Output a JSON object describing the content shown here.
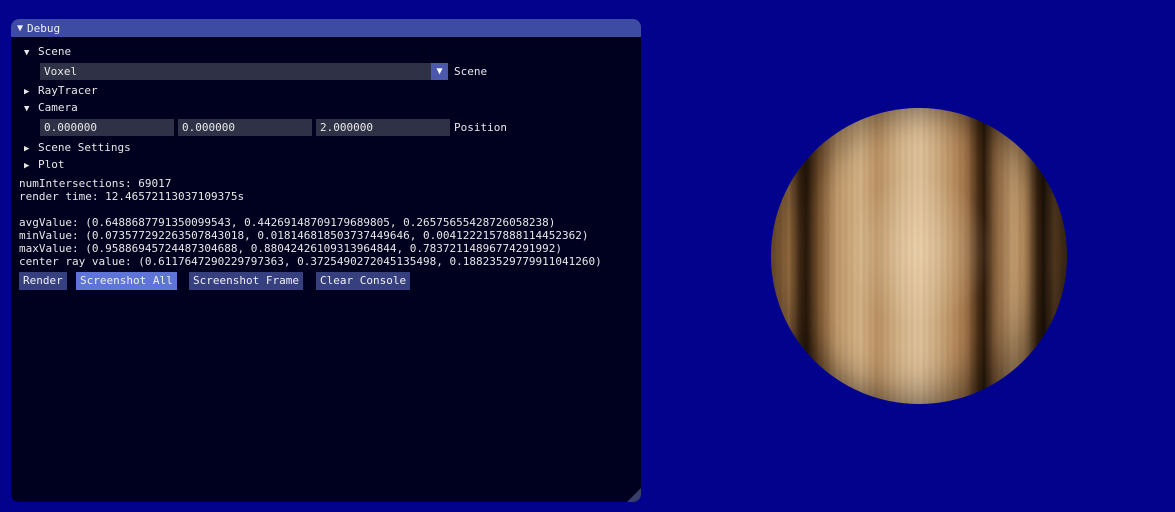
{
  "window": {
    "title": "Debug",
    "title_arrow": "▼"
  },
  "scene": {
    "label": "Scene",
    "selected": "Voxel",
    "combo_label": "Scene"
  },
  "tree": {
    "raytracer": "RayTracer",
    "camera": "Camera",
    "scene_settings": "Scene Settings",
    "plot": "Plot",
    "expanded_arrow": "▼",
    "collapsed_arrow": "▶"
  },
  "camera": {
    "position": [
      "0.000000",
      "0.000000",
      "2.000000"
    ],
    "position_label": "Position"
  },
  "stats": {
    "num_intersections": "numIntersections: 69017",
    "render_time": "render time: 12.46572113037109375s",
    "avg_value": "avgValue: (0.6488687791350099543, 0.44269148709179689805, 0.26575655428726058238)",
    "min_value": "minValue: (0.073577292263507843018, 0.018146818503737449646, 0.0041222157888114452362)",
    "max_value": "maxValue: (0.95886945724487304688, 0.88042426109313964844, 0.78372114896774291992)",
    "center_ray_value": "center ray value: (0.6117647290229797363, 0.3725490272045135498, 0.18823529779911041260)"
  },
  "buttons": {
    "render": "Render",
    "screenshot_all": "Screenshot All",
    "screenshot_frame": "Screenshot Frame",
    "clear_console": "Clear Console"
  },
  "colors": {
    "background": "#02028c",
    "panel": "#00001f",
    "titlebar": "#3d4ba3",
    "button": "#36407e",
    "button_active": "#5e74d6"
  }
}
